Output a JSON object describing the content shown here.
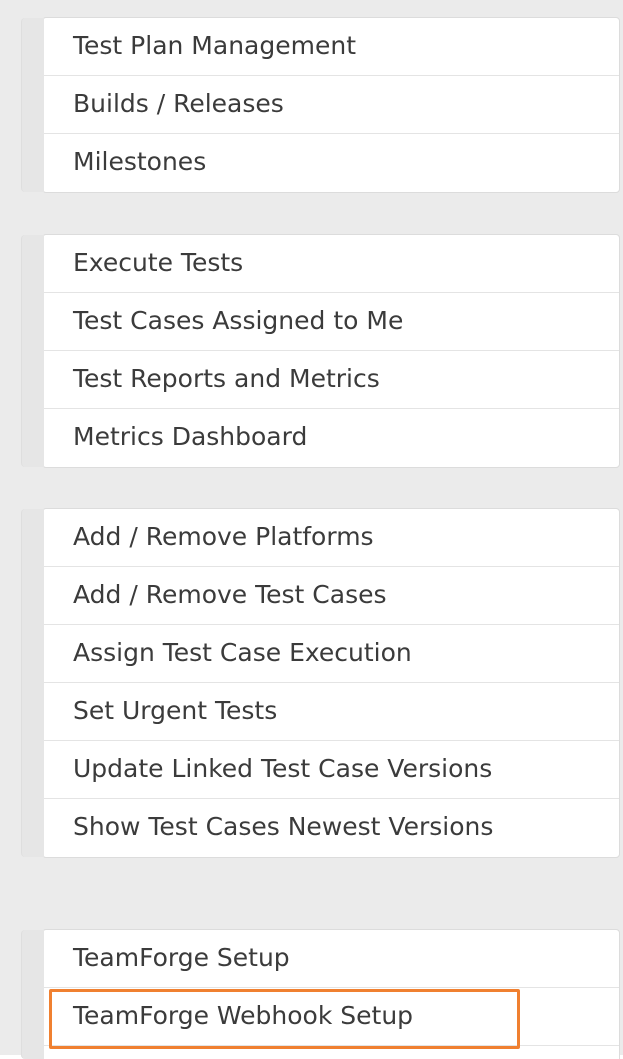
{
  "groups": [
    {
      "items": [
        "Test Plan Management",
        "Builds / Releases",
        "Milestones"
      ]
    },
    {
      "items": [
        "Execute Tests",
        "Test Cases Assigned to Me",
        "Test Reports and Metrics",
        "Metrics Dashboard"
      ]
    },
    {
      "items": [
        "Add / Remove Platforms",
        "Add / Remove Test Cases",
        "Assign Test Case Execution",
        "Set Urgent Tests",
        "Update Linked Test Case Versions",
        "Show Test Cases Newest Versions"
      ]
    },
    {
      "items": [
        "TeamForge Setup",
        "TeamForge Webhook Setup"
      ]
    }
  ],
  "highlighted_item": "TeamForge Webhook Setup",
  "colors": {
    "highlight_border": "#f08030",
    "page_background": "#ebebeb",
    "panel_background": "#ffffff",
    "text": "#3b3b3b"
  }
}
